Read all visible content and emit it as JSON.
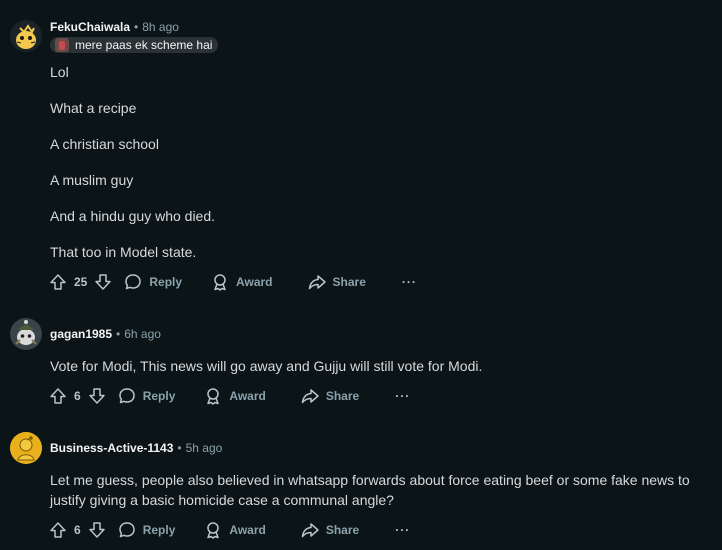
{
  "comments": [
    {
      "username": "FekuChaiwala",
      "time": "8h ago",
      "flair": "mere paas ek scheme hai",
      "paragraphs": [
        "Lol",
        "What a recipe",
        "A christian school",
        "A muslim guy",
        "And a hindu guy who died.",
        "That too in Model state."
      ],
      "votes": "25",
      "reply_label": "Reply",
      "award_label": "Award",
      "share_label": "Share",
      "more_label": "···"
    },
    {
      "username": "gagan1985",
      "time": "6h ago",
      "paragraphs": [
        "Vote for Modi, This news will go away and Gujju will still vote for Modi."
      ],
      "votes": "6",
      "reply_label": "Reply",
      "award_label": "Award",
      "share_label": "Share",
      "more_label": "···"
    },
    {
      "username": "Business-Active-1143",
      "time": "5h ago",
      "paragraphs": [
        "Let me guess, people also believed in whatsapp forwards about force eating beef or some fake news to justify giving a basic homicide case a communal angle?"
      ],
      "votes": "6",
      "reply_label": "Reply",
      "award_label": "Award",
      "share_label": "Share",
      "more_label": "···"
    }
  ],
  "icons": {
    "upvote": "upvote-icon",
    "downvote": "downvote-icon",
    "reply": "speech-bubble-icon",
    "award": "award-ribbon-icon",
    "share": "share-arrow-icon",
    "more": "more-dots-icon"
  },
  "colors": {
    "background": "#0b1416",
    "username": "#f2f4f5",
    "meta": "#8ba2ad",
    "body_text": "#d7dadc",
    "flair_bg": "#2a3236"
  }
}
